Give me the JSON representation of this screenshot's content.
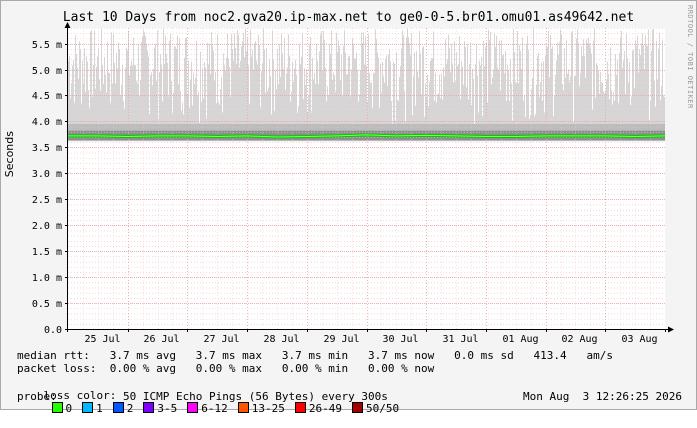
{
  "chart_data": {
    "type": "area",
    "title": "Last 10 Days from noc2.gva20.ip-max.net to ge0-0-5.br01.omu01.as49642.net",
    "watermark": "RRDTOOL / TOBI OETIKER",
    "ylabel": "Seconds",
    "ylim": [
      0,
      5.8
    ],
    "yticks": [
      {
        "value": 0.0,
        "label": "0.0"
      },
      {
        "value": 0.5,
        "label": "0.5 m"
      },
      {
        "value": 1.0,
        "label": "1.0 m"
      },
      {
        "value": 1.5,
        "label": "1.5 m"
      },
      {
        "value": 2.0,
        "label": "2.0 m"
      },
      {
        "value": 2.5,
        "label": "2.5 m"
      },
      {
        "value": 3.0,
        "label": "3.0 m"
      },
      {
        "value": 3.5,
        "label": "3.5 m"
      },
      {
        "value": 4.0,
        "label": "4.0 m"
      },
      {
        "value": 4.5,
        "label": "4.5 m"
      },
      {
        "value": 5.0,
        "label": "5.0 m"
      },
      {
        "value": 5.5,
        "label": "5.5 m"
      }
    ],
    "xrange_days": [
      0,
      10
    ],
    "xticks": [
      {
        "day": 1,
        "label": "25 Jul"
      },
      {
        "day": 2,
        "label": "26 Jul"
      },
      {
        "day": 3,
        "label": "27 Jul"
      },
      {
        "day": 4,
        "label": "28 Jul"
      },
      {
        "day": 5,
        "label": "29 Jul"
      },
      {
        "day": 6,
        "label": "30 Jul"
      },
      {
        "day": 7,
        "label": "31 Jul"
      },
      {
        "day": 8,
        "label": "01 Aug"
      },
      {
        "day": 9,
        "label": "02 Aug"
      },
      {
        "day": 10,
        "label": "03 Aug"
      }
    ],
    "grid": true,
    "series": [
      {
        "name": "median rtt",
        "color": "#00cc00",
        "x": [
          0,
          0.5,
          1,
          1.5,
          2,
          2.5,
          3,
          3.5,
          4,
          4.5,
          5,
          5.5,
          6,
          6.5,
          7,
          7.5,
          8,
          8.5,
          9,
          9.5,
          10
        ],
        "values": [
          3.72,
          3.72,
          3.71,
          3.72,
          3.72,
          3.71,
          3.72,
          3.7,
          3.71,
          3.72,
          3.74,
          3.72,
          3.73,
          3.72,
          3.71,
          3.71,
          3.72,
          3.72,
          3.72,
          3.71,
          3.72
        ]
      }
    ],
    "smoke": {
      "band_min": 3.62,
      "band_dense_top": 3.95,
      "spike_max": 5.8,
      "color": "#b0b0b0"
    }
  },
  "legend": {
    "stats_line": "median rtt:   3.7 ms avg   3.7 ms max   3.7 ms min   3.7 ms now   0.0 ms sd   413.4   am/s",
    "loss_line": "packet loss:  0.00 % avg   0.00 % max   0.00 % min   0.00 % now",
    "loss_color_label": "loss color:",
    "loss_colors": [
      {
        "label": "0",
        "color": "#26ff00"
      },
      {
        "label": "1",
        "color": "#00b8ff"
      },
      {
        "label": "2",
        "color": "#0059ff"
      },
      {
        "label": "3-5",
        "color": "#7e00ff"
      },
      {
        "label": "6-12",
        "color": "#ff00ff"
      },
      {
        "label": "13-25",
        "color": "#ff5500"
      },
      {
        "label": "26-49",
        "color": "#ff0000"
      },
      {
        "label": "50/50",
        "color": "#a10000"
      }
    ],
    "probe_line": "probe:          50 ICMP Echo Pings (56 Bytes) every 300s",
    "date": "Mon Aug  3 12:26:25 2026"
  }
}
